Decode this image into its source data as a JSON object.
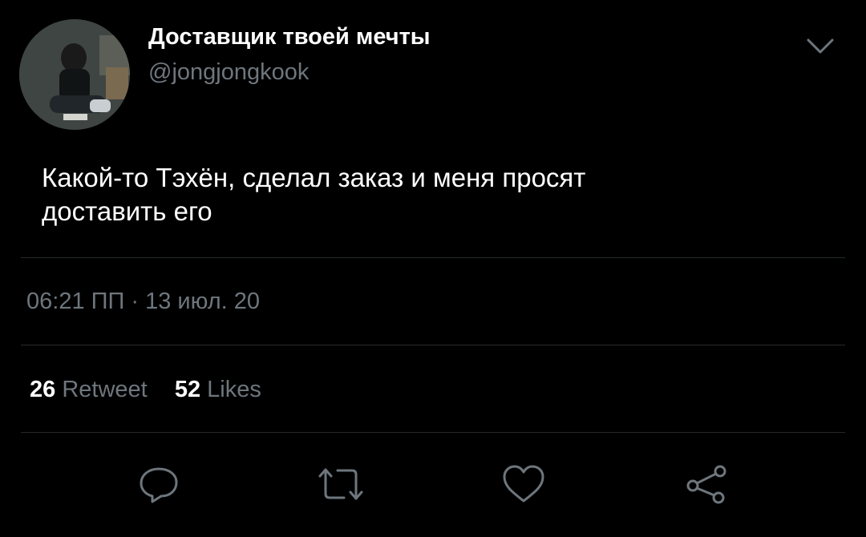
{
  "author": {
    "display_name": "Доставщик твоей мечты",
    "handle": "@jongjongkook"
  },
  "tweet": {
    "text": "Какой-то Тэхён, сделал заказ и меня просят\nдоставить его",
    "timestamp": "06:21 ПП · 13 июл. 20"
  },
  "stats": {
    "retweets_count": "26",
    "retweets_label": "Retweet",
    "likes_count": "52",
    "likes_label": "Likes"
  },
  "icons": {
    "more": "chevron-down-icon",
    "reply": "reply-icon",
    "retweet": "retweet-icon",
    "like": "heart-icon",
    "share": "share-icon"
  },
  "colors": {
    "background": "#000000",
    "primary_text": "#ffffff",
    "secondary_text": "#6e767d",
    "divider": "#262a2e"
  }
}
